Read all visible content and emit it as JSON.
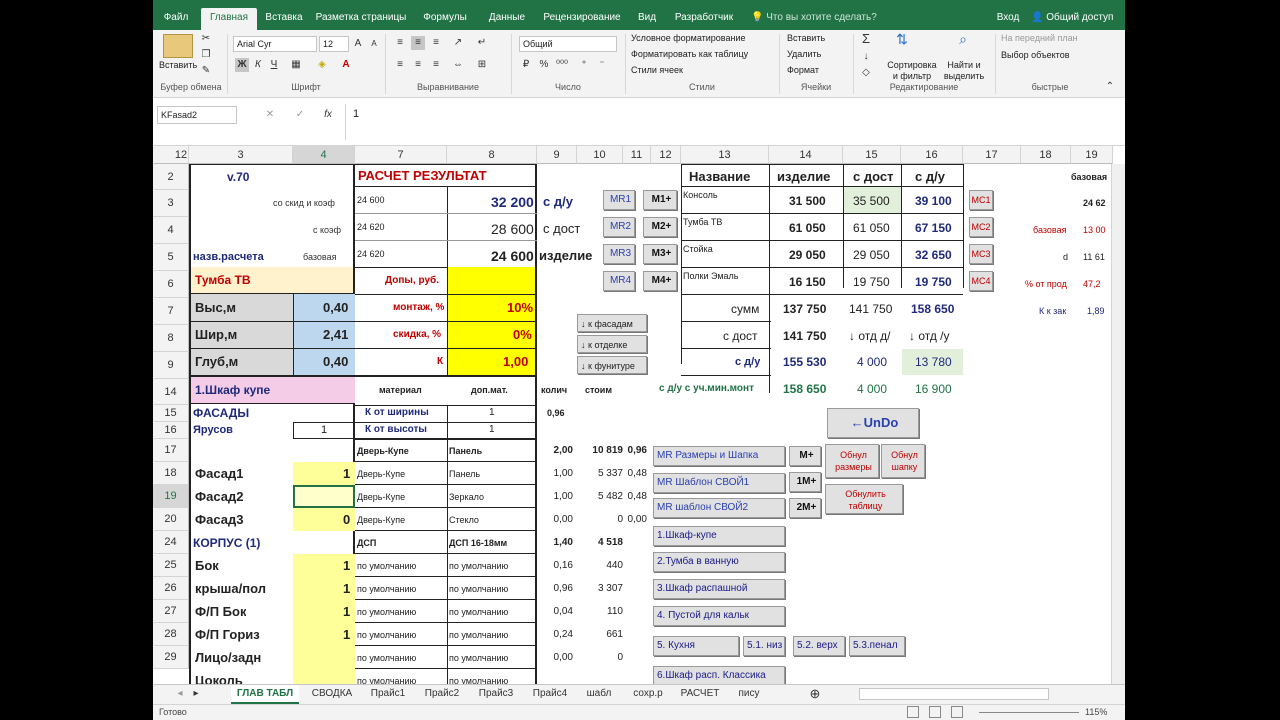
{
  "ribbon": {
    "tabs": [
      "Файл",
      "Главная",
      "Вставка",
      "Разметка страницы",
      "Формулы",
      "Данные",
      "Рецензирование",
      "Вид",
      "Разработчик"
    ],
    "tell_me": "Что вы хотите сделать?",
    "sign_in": "Вход",
    "share": "Общий доступ",
    "paste": "Вставить",
    "font": "Arial Cyr",
    "size": "12",
    "number_format": "Общий",
    "bold": "Ж",
    "italic": "К",
    "underline": "Ч",
    "cond_format": "Условное форматирование",
    "format_table": "Форматировать как таблицу",
    "cell_styles": "Стили ячеек",
    "insert": "Вставить",
    "delete": "Удалить",
    "format": "Формат",
    "sort": "Сортировка и фильтр",
    "find": "Найти и выделить",
    "front": "На передний план",
    "select_objects": "Выбор объектов",
    "groups": [
      "Буфер обмена",
      "Шрифт",
      "Выравнивание",
      "Число",
      "Стили",
      "Ячейки",
      "Редактирование",
      "быстрые"
    ]
  },
  "formula_bar": {
    "name_box": "KFasad2",
    "fx": "fx",
    "value": "1"
  },
  "columns": [
    "12",
    "3",
    "4",
    "7",
    "8",
    "9",
    "10",
    "11",
    "12",
    "13",
    "14",
    "15",
    "16",
    "17",
    "18",
    "19"
  ],
  "rows": [
    "2",
    "3",
    "4",
    "5",
    "6",
    "7",
    "8",
    "9",
    "14",
    "15",
    "16",
    "17",
    "18",
    "19",
    "20",
    "24",
    "25",
    "26",
    "27",
    "28",
    "29"
  ],
  "left": {
    "version": "v.70",
    "calc_name_label": "назв.расчета",
    "labels": [
      "со скид и коэф",
      "с коэф",
      "базовая"
    ],
    "item": "Тумба ТВ",
    "dims": [
      {
        "label": "Выс,м",
        "value": "0,40"
      },
      {
        "label": "Шир,м",
        "value": "2,41"
      },
      {
        "label": "Глуб,м",
        "value": "0,40"
      }
    ],
    "cabinet": "1.Шкаф купе",
    "facades": "ФАСАДЫ",
    "tiers": "Ярусов",
    "tiers_value": "1",
    "facade_rows": [
      {
        "label": "Фасад1",
        "value": "1"
      },
      {
        "label": "Фасад2",
        "value": ""
      },
      {
        "label": "Фасад3",
        "value": "0"
      }
    ],
    "body": "КОРПУС (1)",
    "body_rows": [
      {
        "label": "Бок",
        "value": "1"
      },
      {
        "label": "крыша/пол",
        "value": "1"
      },
      {
        "label": "Ф/П Бок",
        "value": "1"
      },
      {
        "label": "Ф/П Гориз",
        "value": "1"
      },
      {
        "label": "Лицо/задн",
        "value": ""
      },
      {
        "label": "Цоколь",
        "value": ""
      }
    ]
  },
  "result": {
    "title": "РАСЧЕТ РЕЗУЛЬТАТ",
    "small": [
      "24 600",
      "24 620",
      "24 620"
    ],
    "big": [
      "32 200",
      "28 600",
      "24 600"
    ],
    "tags": [
      "с д/у",
      "с дост",
      "изделие"
    ],
    "extras": "Допы, руб.",
    "install": "монтаж, %",
    "install_val": "10%",
    "discount": "скидка, %",
    "discount_val": "0%",
    "k": "К",
    "k_val": "1,00"
  },
  "mid": {
    "h_material": "материал",
    "h_addmat": "доп.мат.",
    "h_qty": "колич",
    "h_cost": "стоим",
    "k_width": "К от ширины",
    "k_width_val": "1",
    "k_width_n": "0,96",
    "k_height": "К от высоты",
    "k_height_val": "1",
    "r17": [
      "Дверь-Купе",
      "Панель",
      "2,00",
      "10 819",
      "0,96"
    ],
    "r18": [
      "Дверь-Купе",
      "Панель",
      "1,00",
      "5 337",
      "0,48"
    ],
    "r19": [
      "Дверь-Купе",
      "Зеркало",
      "1,00",
      "5 482",
      "0,48"
    ],
    "r20": [
      "Дверь-Купе",
      "Стекло",
      "0,00",
      "0",
      "0,00"
    ],
    "r24": [
      "ДСП",
      "ДСП 16-18мм",
      "1,40",
      "4 518",
      ""
    ],
    "r25": [
      "по умолчанию",
      "по умолчанию",
      "0,16",
      "440",
      ""
    ],
    "r26": [
      "по умолчанию",
      "по умолчанию",
      "0,96",
      "3 307",
      ""
    ],
    "r27": [
      "по умолчанию",
      "по умолчанию",
      "0,04",
      "110",
      ""
    ],
    "r28": [
      "по умолчанию",
      "по умолчанию",
      "0,24",
      "661",
      ""
    ],
    "r29": [
      "по умолчанию",
      "по умолчанию",
      "0,00",
      "0",
      ""
    ],
    "r30": [
      "по умолчанию",
      "по умолчанию",
      "",
      "",
      ""
    ]
  },
  "nav_buttons": [
    "↓ к фасадам",
    "↓ к отделке",
    "↓ к фунитуре"
  ],
  "mr_buttons": [
    "MR1",
    "MR2",
    "MR3",
    "MR4"
  ],
  "m_buttons": [
    "M1+",
    "M2+",
    "M3+",
    "M4+"
  ],
  "mc_buttons": [
    "MC1",
    "MC2",
    "MC3",
    "MC4"
  ],
  "table": {
    "headers": [
      "Название",
      "изделие",
      "с дост",
      "с д/у"
    ],
    "rows": [
      {
        "name": "Консоль",
        "a": "31 500",
        "b": "35 500",
        "c": "39 100"
      },
      {
        "name": "Тумба ТВ",
        "a": "61 050",
        "b": "61 050",
        "c": "67 150"
      },
      {
        "name": "Стойка",
        "a": "29 050",
        "b": "29 050",
        "c": "32 650"
      },
      {
        "name": "Полки Эмаль",
        "a": "16 150",
        "b": "19 750",
        "c": "19 750"
      }
    ],
    "sum_label": "сумм",
    "sum": [
      "137 750",
      "141 750",
      "158 650"
    ],
    "dost_label": "с дост",
    "dost": "141 750",
    "otd_d": "↓ отд д/",
    "otd_u": "↓ отд /у",
    "du_label": "с д/у",
    "du": [
      "155 530",
      "4 000",
      "13 780"
    ],
    "min_label": "с д/у с уч.мин.монт",
    "min": [
      "158 650",
      "4 000",
      "16 900"
    ]
  },
  "right": {
    "base": "базовая",
    "base_v": "24 62",
    "base2": "базовая",
    "base2_v": "13 00",
    "d": "d",
    "d_v": "11 61",
    "pct": "% от прод",
    "pct_v": "47,2",
    "kzak": "К к зак",
    "kzak_v": "1,89"
  },
  "buttons": {
    "undo": "←UnDo",
    "mr_sizes": "MR Размеры и Шапка",
    "mr_own": "MR Шаблон СВОЙ1",
    "mr_own2": "MR шаблон СВОЙ2",
    "mplus": "M+",
    "m1": "1M+",
    "m2": "2M+",
    "reset_sizes": "Обнул размеры",
    "reset_head": "Обнул шапку",
    "reset_table": "Обнулить таблицу",
    "t1": "1.Шкаф-купе",
    "t2": "2.Тумба в ванную",
    "t3": "3.Шкаф распашной",
    "t4": "4. Пустой для кальк",
    "t5": "5. Кухня",
    "t51": "5.1. низ",
    "t52": "5.2. верх",
    "t53": "5.3.пенал",
    "t6": "6.Шкаф расп. Классика"
  },
  "sheet_tabs": [
    "ГЛАВ ТАБЛ",
    "СВОДКА",
    "Прайс1",
    "Прайс2",
    "Прайс3",
    "Прайс4",
    "шабл",
    "сохр.р",
    "РАСЧЕТ",
    "пису"
  ],
  "status": {
    "ready": "Готово",
    "zoom": "115%"
  }
}
